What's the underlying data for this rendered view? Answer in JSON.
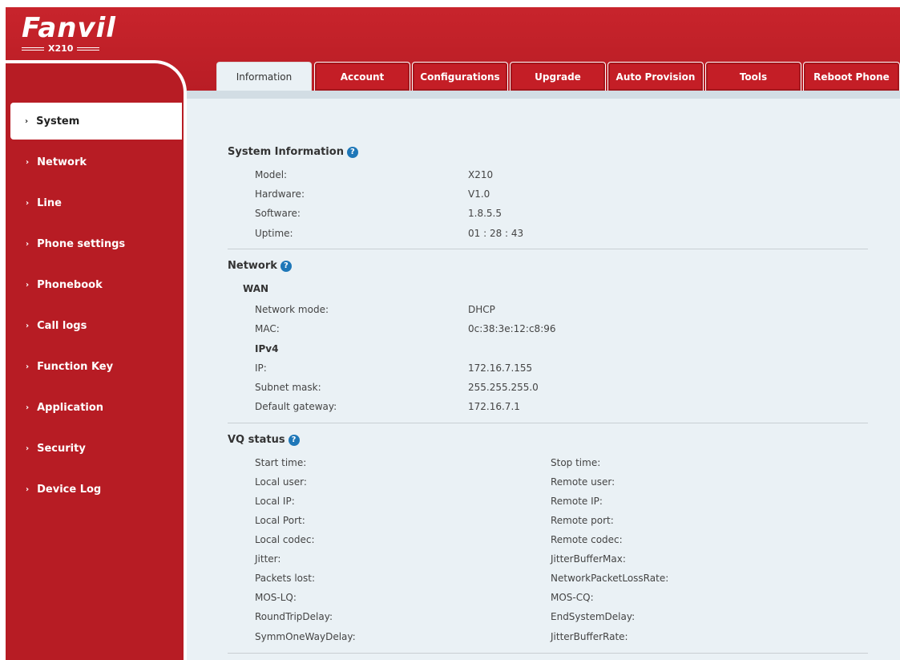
{
  "header": {
    "logo_text": "Fanvil",
    "model": "X210"
  },
  "sidebar": {
    "items": [
      {
        "label": "System"
      },
      {
        "label": "Network"
      },
      {
        "label": "Line"
      },
      {
        "label": "Phone settings"
      },
      {
        "label": "Phonebook"
      },
      {
        "label": "Call logs"
      },
      {
        "label": "Function Key"
      },
      {
        "label": "Application"
      },
      {
        "label": "Security"
      },
      {
        "label": "Device Log"
      }
    ],
    "chevron": "›"
  },
  "tabs": [
    {
      "label": "Information"
    },
    {
      "label": "Account"
    },
    {
      "label": "Configurations"
    },
    {
      "label": "Upgrade"
    },
    {
      "label": "Auto Provision"
    },
    {
      "label": "Tools"
    },
    {
      "label": "Reboot Phone"
    }
  ],
  "help_glyph": "?",
  "system_info": {
    "title": "System Information",
    "rows": [
      {
        "label": "Model:",
        "value": "X210"
      },
      {
        "label": "Hardware:",
        "value": "V1.0"
      },
      {
        "label": "Software:",
        "value": "1.8.5.5"
      },
      {
        "label": "Uptime:",
        "value": "01 : 28 : 43"
      }
    ]
  },
  "network": {
    "title": "Network",
    "wan_label": "WAN",
    "rows": [
      {
        "label": "Network mode:",
        "value": "DHCP"
      },
      {
        "label": "MAC:",
        "value": "0c:38:3e:12:c8:96"
      }
    ],
    "ipv4_label": "IPv4",
    "ipv4_rows": [
      {
        "label": "IP:",
        "value": "172.16.7.155"
      },
      {
        "label": "Subnet mask:",
        "value": "255.255.255.0"
      },
      {
        "label": "Default gateway:",
        "value": "172.16.7.1"
      }
    ]
  },
  "vq_status": {
    "title": "VQ status",
    "left": [
      "Start time:",
      "Local user:",
      "Local IP:",
      "Local Port:",
      "Local codec:",
      "Jitter:",
      "Packets lost:",
      "MOS-LQ:",
      "RoundTripDelay:",
      "SymmOneWayDelay:"
    ],
    "right": [
      "Stop time:",
      "Remote user:",
      "Remote IP:",
      "Remote port:",
      "Remote codec:",
      "JitterBufferMax:",
      "NetworkPacketLossRate:",
      "MOS-CQ:",
      "EndSystemDelay:",
      "JitterBufferRate:"
    ]
  }
}
